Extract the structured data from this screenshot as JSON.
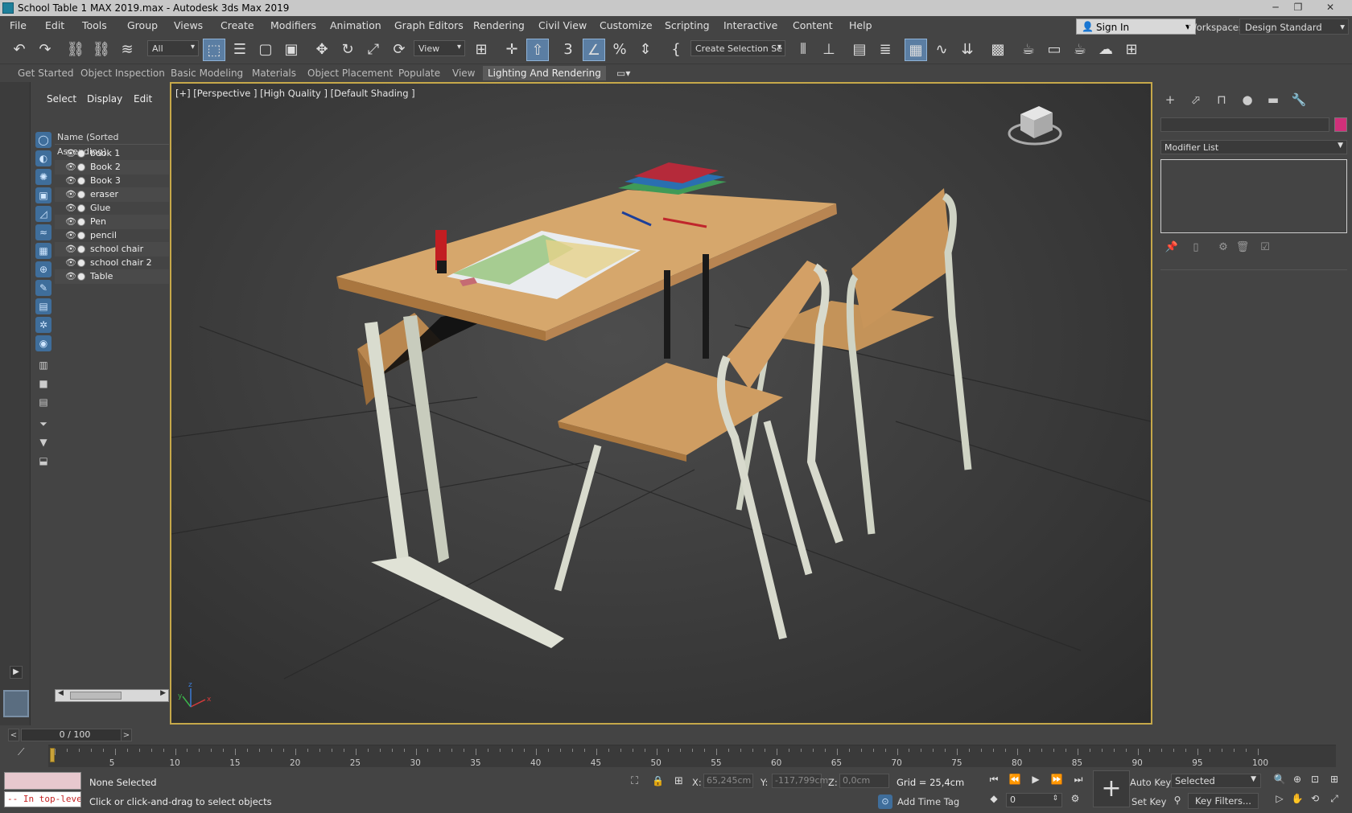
{
  "window": {
    "title": "School Table 1 MAX 2019.max - Autodesk 3ds Max 2019",
    "minimize": "─",
    "restore": "❐",
    "close": "✕"
  },
  "menu": [
    "File",
    "Edit",
    "Tools",
    "Group",
    "Views",
    "Create",
    "Modifiers",
    "Animation",
    "Graph Editors",
    "Rendering",
    "Civil View",
    "Customize",
    "Scripting",
    "Interactive",
    "Content",
    "Help"
  ],
  "account": {
    "sign_in": "Sign In",
    "workspaces_label": "Workspaces:",
    "workspace": "Design Standard"
  },
  "toolbar": {
    "selection_filter": "All",
    "ref_coord": "View",
    "named_selection_placeholder": "Create Selection Se",
    "icons": [
      "undo-icon",
      "redo-icon",
      "link-icon",
      "unlink-icon",
      "bind-space-warp-icon",
      "select-object-icon",
      "select-by-name-icon",
      "rect-region-icon",
      "window-crossing-icon",
      "move-icon",
      "rotate-icon",
      "scale-icon",
      "place-icon",
      "pivot-icon",
      "snap-3d-icon",
      "angle-snap-icon",
      "percent-snap-icon",
      "spinner-snap-icon",
      "edit-named-sel-icon",
      "mirror-icon",
      "align-icon",
      "scene-explorer-icon",
      "layer-explorer-icon",
      "ribbon-toggle-icon",
      "curve-editor-icon",
      "schematic-icon",
      "material-editor-icon",
      "render-setup-icon",
      "rendered-frame-icon",
      "render-icon",
      "render-cloud-icon",
      "render-iterative-icon",
      "render-a360-icon"
    ]
  },
  "ribbon_tabs": [
    "Get Started",
    "Object Inspection",
    "Basic Modeling",
    "Materials",
    "Object Placement",
    "Populate",
    "View",
    "Lighting And Rendering"
  ],
  "ribbon_active": "Lighting And Rendering",
  "explorer": {
    "tabs": [
      "Select",
      "Display",
      "Edit"
    ],
    "column_header": "Name (Sorted Ascending)",
    "objects": [
      "book 1",
      "Book 2",
      "Book 3",
      "eraser",
      "Glue",
      "Pen",
      "pencil",
      "school chair",
      "school chair 2",
      "Table"
    ]
  },
  "viewport": {
    "label": "[+] [Perspective ] [High Quality ] [Default Shading ]",
    "axis_labels": {
      "x": "x",
      "y": "y",
      "z": "z"
    }
  },
  "command_panel": {
    "tabs": [
      "create-tab-icon",
      "modify-tab-icon",
      "hierarchy-tab-icon",
      "motion-tab-icon",
      "display-tab-icon",
      "utilities-tab-icon"
    ],
    "name_value": "",
    "modifier_list": "Modifier List",
    "object_color": "#d0307a"
  },
  "time": {
    "frame_display": "0 / 100",
    "ticks": [
      "5",
      "10",
      "15",
      "20",
      "25",
      "30",
      "35",
      "40",
      "45",
      "50",
      "55",
      "60",
      "65",
      "70",
      "75",
      "80",
      "85",
      "90",
      "95",
      "100"
    ]
  },
  "status": {
    "maxscript_output": "-- In top-level",
    "selection": "None Selected",
    "prompt": "Click or click-and-drag to select objects",
    "x_label": "X:",
    "x_value": "65,245cm",
    "y_label": "Y:",
    "y_value": "-117,799cm",
    "z_label": "Z:",
    "z_value": "0,0cm",
    "grid": "Grid = 25,4cm",
    "add_time_tag": "Add Time Tag",
    "auto_key": "Auto Key",
    "set_key": "Set Key",
    "key_set_drop": "Selected",
    "current_frame": "0",
    "key_filters": "Key Filters..."
  },
  "colors": {
    "viewport_border": "#c6a84a",
    "accent": "#5b7ea3"
  }
}
